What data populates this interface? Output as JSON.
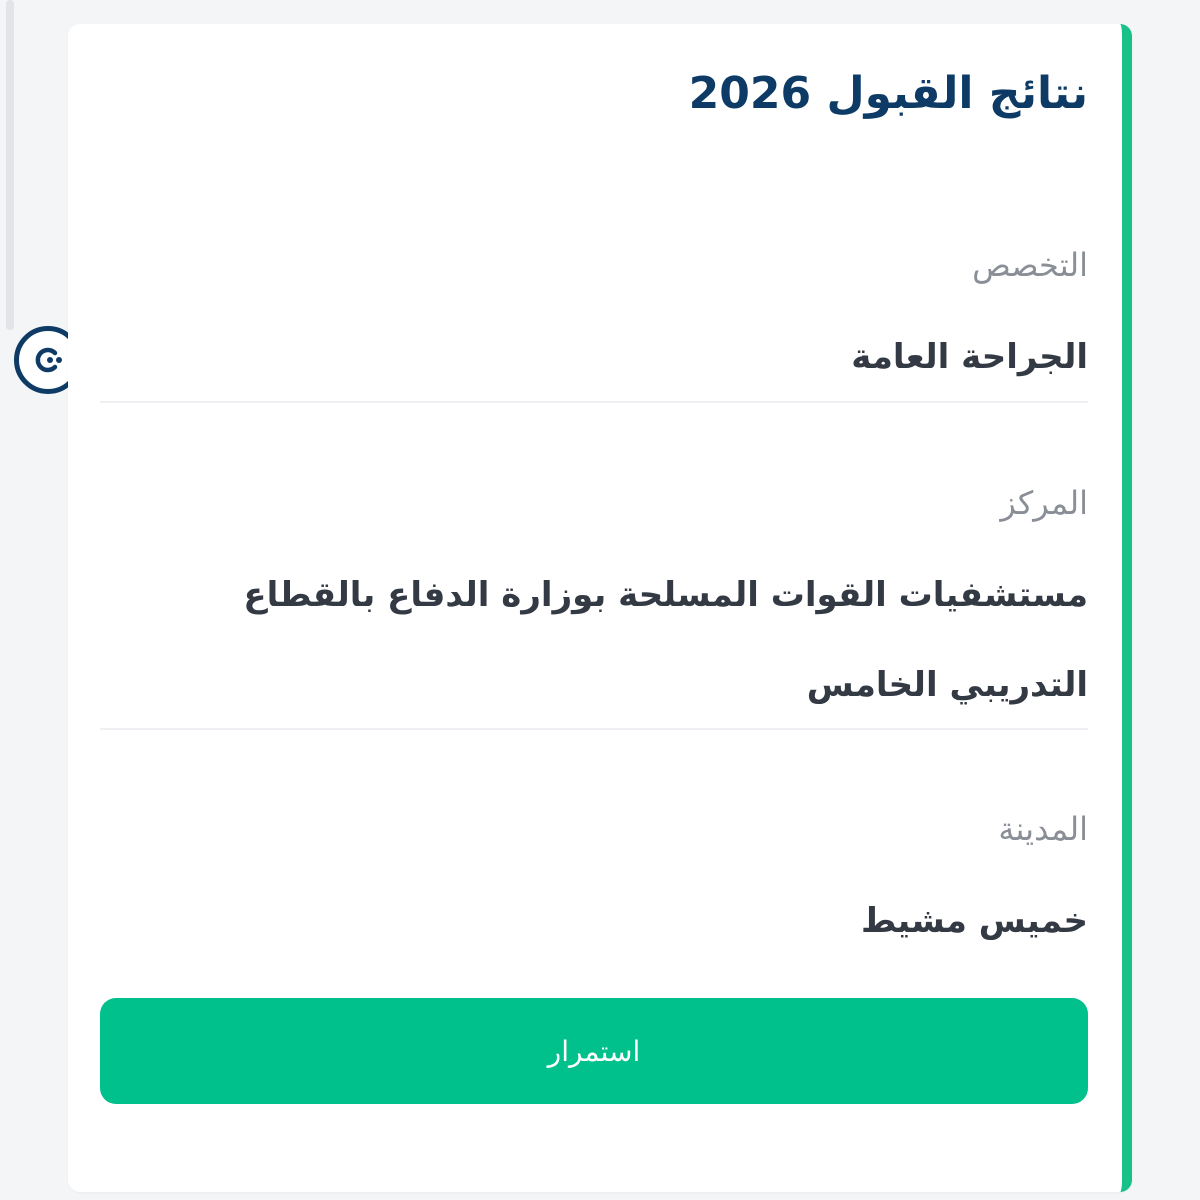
{
  "card": {
    "title": "نتائج القبول 2026",
    "accent_color": "#17c188",
    "title_color": "#0d3b66"
  },
  "fields": [
    {
      "label": "التخصص",
      "value": "الجراحة العامة"
    },
    {
      "label": "المركز",
      "value": "مستشفيات القوات المسلحة بوزارة الدفاع بالقطاع التدريبي الخامس"
    },
    {
      "label": "المدينة",
      "value": "خميس مشيط"
    }
  ],
  "actions": {
    "continue_label": "استمرار",
    "button_color": "#00c08b"
  },
  "icons": {
    "accessibility": "accessibility-widget-icon"
  }
}
